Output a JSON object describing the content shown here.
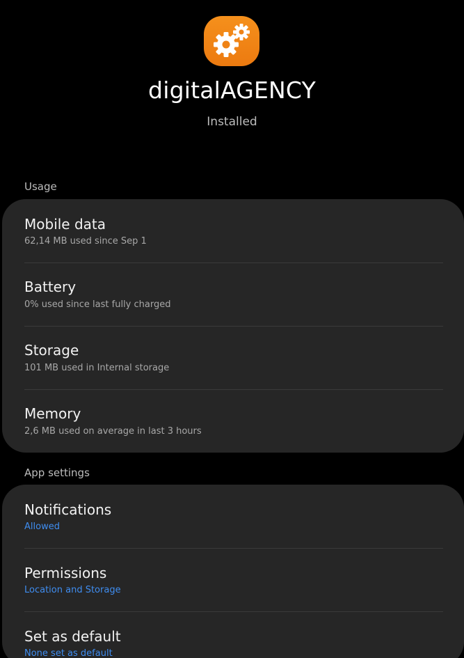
{
  "header": {
    "icon": "gears-icon",
    "icon_color": "#ef8316",
    "app_name": "digitalAGENCY",
    "status": "Installed"
  },
  "usage": {
    "label": "Usage",
    "items": [
      {
        "title": "Mobile data",
        "subtitle": "62,14 MB used since Sep 1"
      },
      {
        "title": "Battery",
        "subtitle": "0% used since last fully charged"
      },
      {
        "title": "Storage",
        "subtitle": "101 MB used in Internal storage"
      },
      {
        "title": "Memory",
        "subtitle": "2,6 MB used on average in last 3 hours"
      }
    ]
  },
  "app_settings": {
    "label": "App settings",
    "accent_color": "#3f8df0",
    "items": [
      {
        "title": "Notifications",
        "subtitle": "Allowed"
      },
      {
        "title": "Permissions",
        "subtitle": "Location and Storage"
      },
      {
        "title": "Set as default",
        "subtitle": "None set as default"
      }
    ]
  }
}
